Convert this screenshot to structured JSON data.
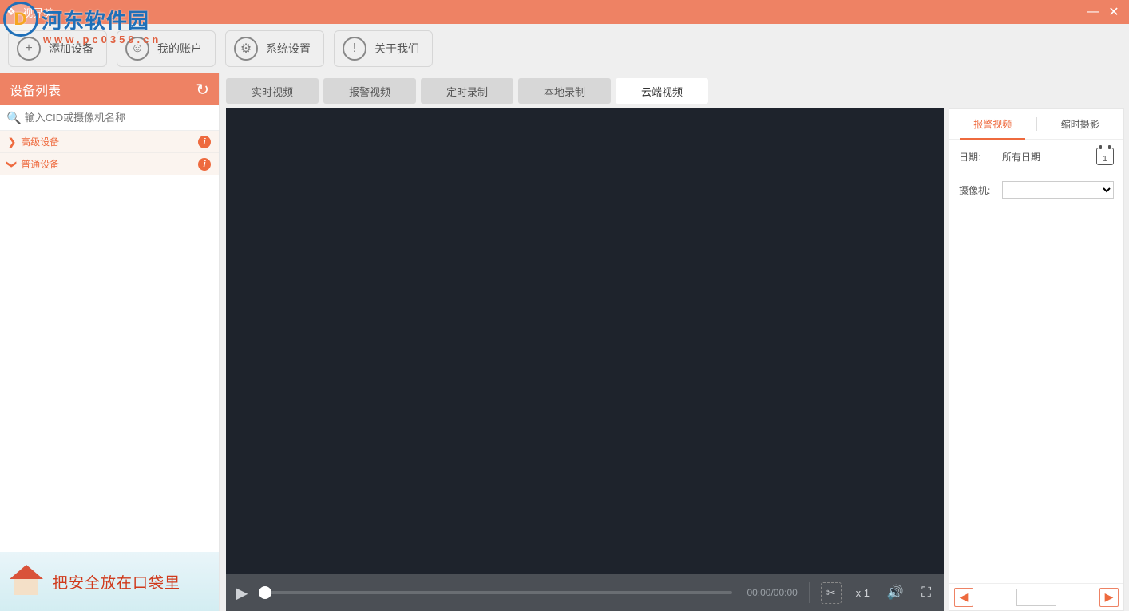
{
  "app": {
    "title": "视界美"
  },
  "watermark": {
    "brand": "河东软件园",
    "logo_letter": "D",
    "url": "www.pc0359.cn"
  },
  "window": {
    "minimize": "—",
    "close": "✕"
  },
  "toolbar": {
    "add_device": "添加设备",
    "my_account": "我的账户",
    "system_settings": "系统设置",
    "about_us": "关于我们"
  },
  "sidebar": {
    "title": "设备列表",
    "search_placeholder": "输入CID或摄像机名称",
    "groups": [
      {
        "chevron": "❯",
        "label": "高级设备"
      },
      {
        "chevron": "❯",
        "label": "普通设备"
      }
    ],
    "info_glyph": "i",
    "promo_text": "把安全放在口袋里"
  },
  "tabs": {
    "items": [
      "实时视频",
      "报警视频",
      "定时录制",
      "本地录制",
      "云端视频"
    ],
    "active_index": 4
  },
  "player": {
    "time": "00:00/00:00",
    "speed": "x 1"
  },
  "right_panel": {
    "tabs": {
      "alert": "报警视频",
      "timelapse": "缩时摄影",
      "active": 0
    },
    "date_label": "日期:",
    "date_value": "所有日期",
    "calendar_day": "1",
    "camera_label": "摄像机:"
  },
  "icons": {
    "plus": "+",
    "user": "☺",
    "gear": "⚙",
    "info": "!",
    "refresh": "↻",
    "search": "🔍",
    "play": "▶",
    "scissors": "✂",
    "volume": "🔊",
    "fullscreen": "⛶",
    "prev": "◀",
    "next": "▶"
  }
}
